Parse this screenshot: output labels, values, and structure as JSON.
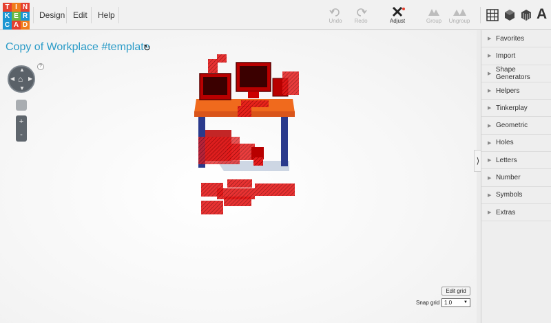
{
  "logo": {
    "letters": [
      "T",
      "I",
      "N",
      "K",
      "E",
      "R",
      "C",
      "A",
      "D"
    ]
  },
  "menu": {
    "design": "Design",
    "edit": "Edit",
    "help": "Help"
  },
  "toolbar": {
    "undo": "Undo",
    "redo": "Redo",
    "adjust": "Adjust",
    "group": "Group",
    "ungroup": "Ungroup"
  },
  "document": {
    "title": "Copy of Workplace #template"
  },
  "navigation": {
    "help": "?",
    "zoom_in": "+",
    "zoom_out": "-"
  },
  "grid": {
    "edit_label": "Edit grid",
    "snap_label": "Snap grid",
    "snap_value": "1.0"
  },
  "panel": {
    "categories": [
      "Favorites",
      "Import",
      "Shape Generators",
      "Helpers",
      "Tinkerplay",
      "Geometric",
      "Holes",
      "Letters",
      "Number",
      "Symbols",
      "Extras"
    ],
    "collapse": "⟩"
  },
  "colors": {
    "accent": "#2a9bc7",
    "model_red": "#d40000",
    "desk_orange": "#f06a1d",
    "desk_blue": "#2a3a8c"
  }
}
